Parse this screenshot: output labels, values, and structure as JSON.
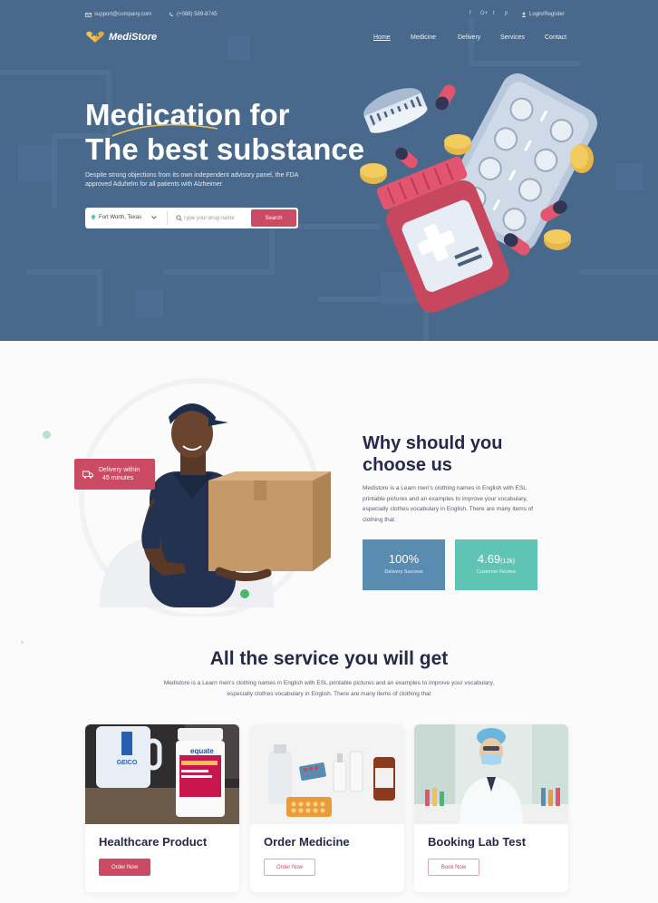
{
  "topbar": {
    "email": "support@company.com",
    "phone": "(+088) 589-8745",
    "social": [
      "f",
      "G+",
      "t",
      "p"
    ],
    "login": "Login/Register"
  },
  "nav": {
    "brand": "MediStore",
    "links": [
      "Home",
      "Medicine",
      "Delivery",
      "Services",
      "Contact"
    ],
    "active": "Home"
  },
  "hero": {
    "title_line1": "Medication for",
    "title_line2": "The best substance",
    "subtitle": "Despite strong objections from its own independent advisory panel, the FDA approved Aduhelm for all patients with Alzheimer",
    "location": "Fort Worth, Texas",
    "search_placeholder": "Type your drug name",
    "search_button": "Search"
  },
  "why": {
    "badge_line1": "Delivery within",
    "badge_line2": "45 minutes",
    "title_line1": "Why should you",
    "title_line2": "choose us",
    "text": "Medistore is a  Learn men's clothing names in English with ESL printable pictures and an examples to improve your vocabulary, especially clothes vocabulary in English. There are many items of clothing that",
    "stats": [
      {
        "value": "100%",
        "suffix": "",
        "label": "Delivery Success",
        "color": "#5a8bb0"
      },
      {
        "value": "4.69",
        "suffix": "(12k)",
        "label": "Customer Review",
        "color": "#5fc4b4"
      }
    ]
  },
  "services": {
    "title": "All the service you will get",
    "text": "Medistore is a  Learn men's clothing names in English with ESL printable pictures and an examples to improve your vocabulary, especially clothes vocabulary in English. There are many items of clothing that",
    "cards": [
      {
        "title": "Healthcare Product",
        "button": "Order Now"
      },
      {
        "title": "Order Medicine",
        "button": "Order Now"
      },
      {
        "title": "Booking Lab Test",
        "button": "Book Now"
      }
    ],
    "product_label_1": "GEICO",
    "product_label_2": "equate"
  },
  "colors": {
    "hero_bg": "#48698c",
    "accent": "#cb4a64",
    "heading": "#26294a",
    "teal": "#5fc4b4",
    "blue": "#5a8bb0"
  },
  "icons": [
    "mail-icon",
    "phone-icon",
    "facebook-icon",
    "google-plus-icon",
    "twitter-icon",
    "pinterest-icon",
    "user-icon",
    "location-pin-icon",
    "chevron-down-icon",
    "search-icon",
    "truck-icon"
  ]
}
